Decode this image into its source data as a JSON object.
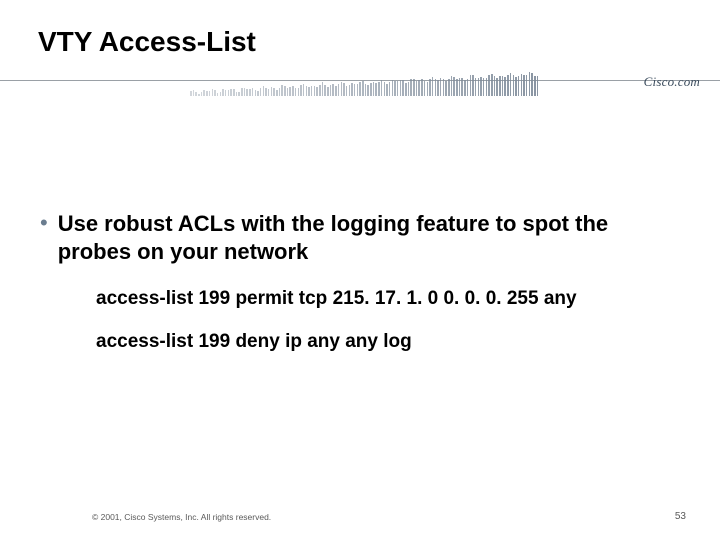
{
  "title": "VTY Access-List",
  "brand": "Cisco.com",
  "bullet": "Use robust ACLs with the logging feature to spot the probes on your network",
  "sub1": "access-list 199 permit tcp 215. 17. 1. 0 0. 0. 0. 255 any",
  "sub2": "access-list 199 deny ip any any log",
  "footer_left": "© 2001, Cisco Systems, Inc. All rights reserved.",
  "footer_right": "53"
}
